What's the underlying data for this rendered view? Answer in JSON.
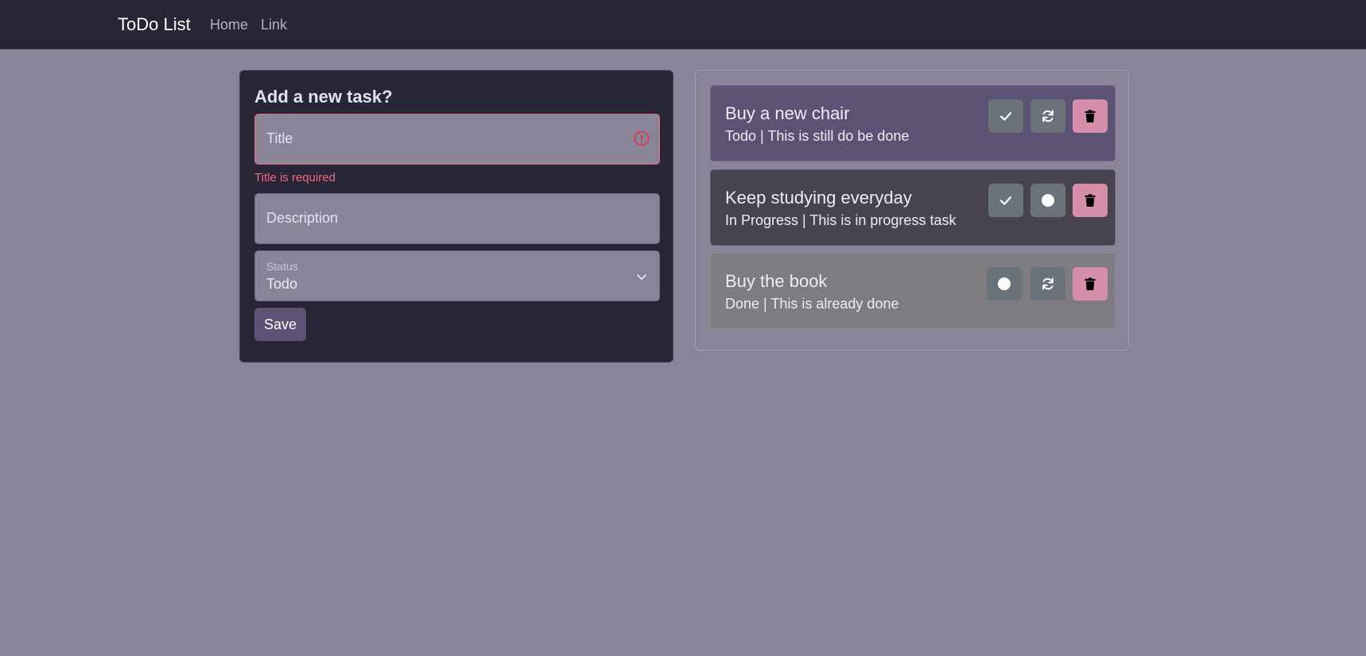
{
  "navbar": {
    "brand": "ToDo List",
    "links": [
      "Home",
      "Link"
    ]
  },
  "form": {
    "heading": "Add a new task?",
    "title_placeholder": "Title",
    "title_error": "Title is required",
    "description_placeholder": "Description",
    "status_label": "Status",
    "status_value": "Todo",
    "save_label": "Save"
  },
  "tasks": [
    {
      "title": "Buy a new chair",
      "subtitle": "Todo | This is still do be done",
      "status": "Todo",
      "color": "#5c5274",
      "buttons": [
        "check-icon",
        "refresh-icon",
        "trash-icon"
      ]
    },
    {
      "title": "Keep studying everyday",
      "subtitle": "In Progress | This is in progress task",
      "status": "In Progress",
      "color": "#48444f",
      "buttons": [
        "check-icon",
        "circle-icon",
        "trash-icon"
      ]
    },
    {
      "title": "Buy the book",
      "subtitle": "Done | This is already done",
      "status": "Done",
      "color": "#7e7c80",
      "buttons": [
        "circle-icon",
        "refresh-icon",
        "trash-icon"
      ]
    }
  ],
  "colors": {
    "page_bg": "#8a8499",
    "navbar_bg": "#282536",
    "accent": "#5c5274",
    "error": "#f06a84",
    "delete_button": "#d58fab",
    "action_button": "#6c727a"
  }
}
